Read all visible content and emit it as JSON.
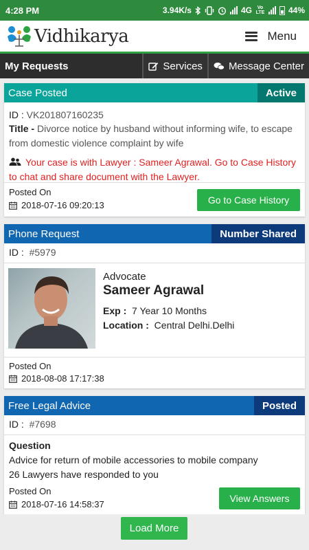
{
  "status_bar": {
    "time": "4:28 PM",
    "net_speed": "3.94K/s",
    "network": "4G",
    "lte": "Vo LTE",
    "battery": "44%"
  },
  "header": {
    "logo_text": "Vidhikarya",
    "menu_label": "Menu"
  },
  "nav": {
    "title": "My Requests",
    "services_label": "Services",
    "message_center_label": "Message Center"
  },
  "cards": [
    {
      "type": "Case Posted",
      "badge": "Active",
      "id_label": "ID :",
      "id_value": "VK201807160235",
      "title_label": "Title -",
      "title_value": "Divorce notice by husband without informing wife, to escape from domestic violence complaint by wife",
      "notice": "Your case is with Lawyer : Sameer Agrawal. Go to Case History to chat and share document with the Lawyer.",
      "posted_label": "Posted On",
      "posted_value": "2018-07-16 09:20:13",
      "action_label": "Go to Case History"
    },
    {
      "type": "Phone Request",
      "badge": "Number Shared",
      "id_label": "ID :",
      "id_value": "#5979",
      "role": "Advocate",
      "name": "Sameer Agrawal",
      "exp_label": "Exp :",
      "exp_value": "7 Year 10 Months",
      "location_label": "Location :",
      "location_value": "Central Delhi.Delhi",
      "posted_label": "Posted On",
      "posted_value": "2018-08-08 17:17:38"
    },
    {
      "type": "Free Legal Advice",
      "badge": "Posted",
      "id_label": "ID :",
      "id_value": "#7698",
      "question_label": "Question",
      "question_text": "Advice for return of mobile accessories to mobile company",
      "responses": "26 Lawyers have responded to you",
      "posted_label": "Posted On",
      "posted_value": "2018-07-16 14:58:37",
      "action_label": "View Answers"
    }
  ],
  "load_more_label": "Load More",
  "colors": {
    "brand_green": "#2e8b3d",
    "teal": "#0aa49a",
    "blue": "#1066b0",
    "dark_blue": "#0c3a7a",
    "notice_red": "#e02020",
    "button_green": "#28b04a"
  },
  "icons": [
    "bluetooth-icon",
    "vibrate-icon",
    "alarm-icon",
    "signal-icon",
    "battery-icon",
    "hamburger-icon",
    "edit-icon",
    "chat-icon",
    "users-icon",
    "calendar-icon"
  ]
}
